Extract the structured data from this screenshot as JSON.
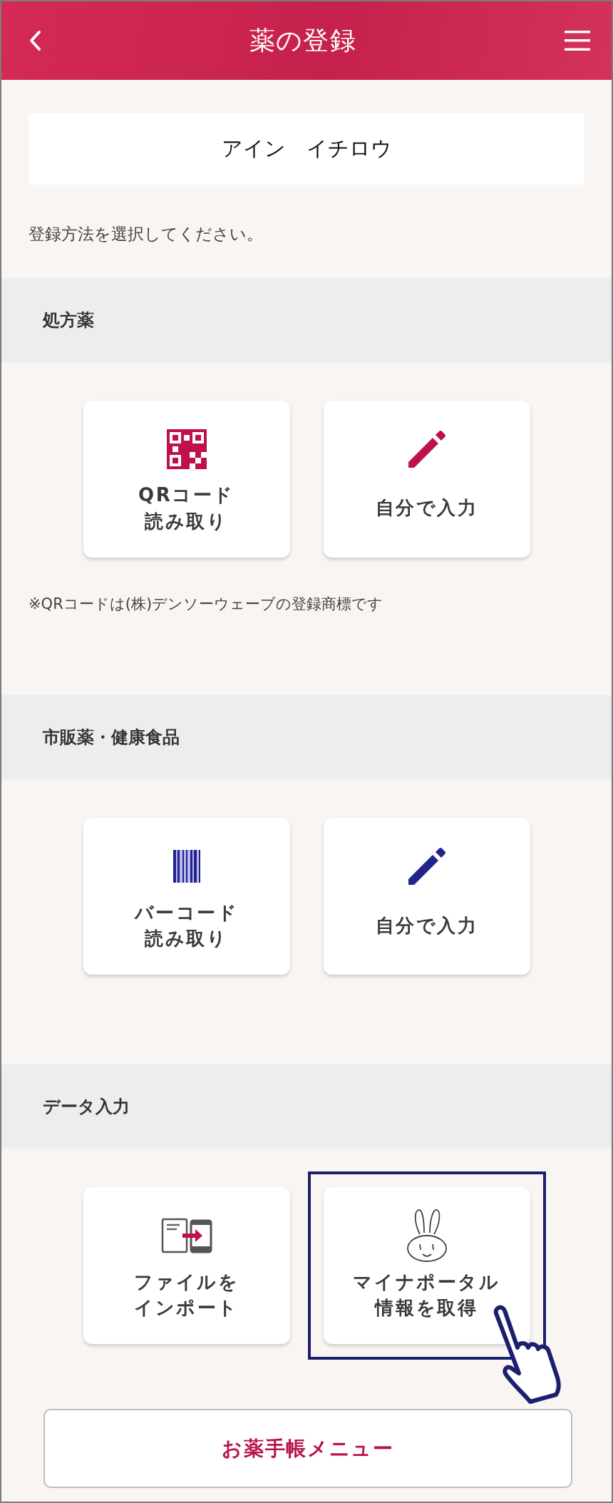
{
  "header": {
    "title": "薬の登録"
  },
  "user_name": "アイン　イチロウ",
  "instruction": "登録方法を選択してください。",
  "sections": [
    {
      "title": "処方薬",
      "cards": [
        {
          "kind": "qr",
          "label_lines": [
            "QRコード",
            "読み取り"
          ],
          "color": "#c0104a",
          "selected": false
        },
        {
          "kind": "manual",
          "label_lines": [
            "自分で入力"
          ],
          "color": "#c0104a",
          "selected": false
        }
      ],
      "note": "※QRコードは(株)デンソーウェーブの登録商標です"
    },
    {
      "title": "市販薬・健康食品",
      "cards": [
        {
          "kind": "barcode",
          "label_lines": [
            "バーコード",
            "読み取り"
          ],
          "color": "#23238e",
          "selected": false
        },
        {
          "kind": "manual",
          "label_lines": [
            "自分で入力"
          ],
          "color": "#23238e",
          "selected": false
        }
      ]
    },
    {
      "title": "データ入力",
      "cards": [
        {
          "kind": "file",
          "label_lines": [
            "ファイルを",
            "インポート"
          ],
          "selected": false
        },
        {
          "kind": "myna",
          "label_lines": [
            "マイナポータル",
            "情報を取得"
          ],
          "selected": true
        }
      ]
    }
  ],
  "menu_button": "お薬手帳メニュー"
}
